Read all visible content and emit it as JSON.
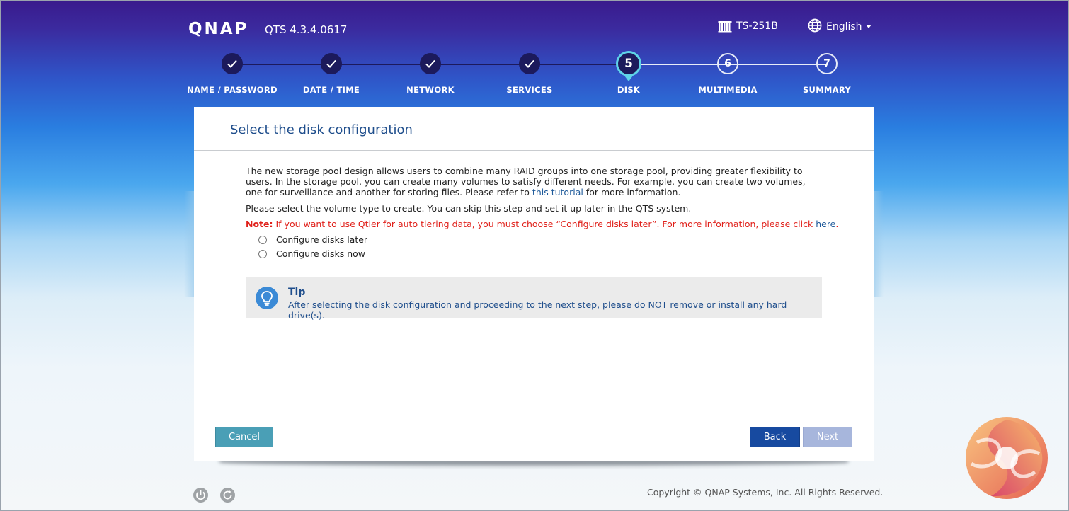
{
  "header": {
    "brand": "QNAP",
    "version": "QTS 4.3.4.0617",
    "device_name": "TS-251B",
    "language": "English"
  },
  "stepper": {
    "current_step": 5,
    "steps": [
      {
        "number": "1",
        "label": "NAME / PASSWORD",
        "status": "done"
      },
      {
        "number": "2",
        "label": "DATE / TIME",
        "status": "done"
      },
      {
        "number": "3",
        "label": "NETWORK",
        "status": "done"
      },
      {
        "number": "4",
        "label": "SERVICES",
        "status": "done"
      },
      {
        "number": "5",
        "label": "DISK",
        "status": "active"
      },
      {
        "number": "6",
        "label": "MULTIMEDIA",
        "status": "todo"
      },
      {
        "number": "7",
        "label": "SUMMARY",
        "status": "todo"
      }
    ]
  },
  "panel": {
    "title": "Select the disk configuration",
    "intro_part1": "The new storage pool design allows users to combine many RAID groups into one storage pool, providing greater flexibility to users. In the storage pool, you can create many volumes to satisfy different needs. For example, you can create two volumes, one for surveillance and another for storing files. Please refer to ",
    "intro_link": "this tutorial",
    "intro_part2": " for more information.",
    "select_text": "Please select the volume type to create. You can skip this step and set it up later in the QTS system.",
    "note_label": "Note:",
    "note_text": " If you want to use Qtier for auto tiering data, you must choose “Configure disks later”. For more information, please click ",
    "note_link": "here",
    "note_end": ".",
    "options": [
      {
        "label": "Configure disks later",
        "selected": false
      },
      {
        "label": "Configure disks now",
        "selected": false
      }
    ],
    "tip": {
      "title": "Tip",
      "text": "After selecting the disk configuration and proceeding to the next step, please do NOT remove or install any hard drive(s)."
    },
    "buttons": {
      "cancel": "Cancel",
      "back": "Back",
      "next": "Next"
    }
  },
  "footer": {
    "copyright": "Copyright © QNAP Systems, Inc. All Rights Reserved.",
    "icons": [
      "power-icon",
      "restart-icon"
    ]
  },
  "colors": {
    "accent_blue": "#174aa0",
    "title_blue": "#1f4e8c",
    "note_red": "#e0201a",
    "cancel_teal": "#4a9fb6",
    "next_disabled": "#a7b6dc",
    "step_done": "#1c1a5c",
    "step_active_ring": "#5fd3e8"
  }
}
